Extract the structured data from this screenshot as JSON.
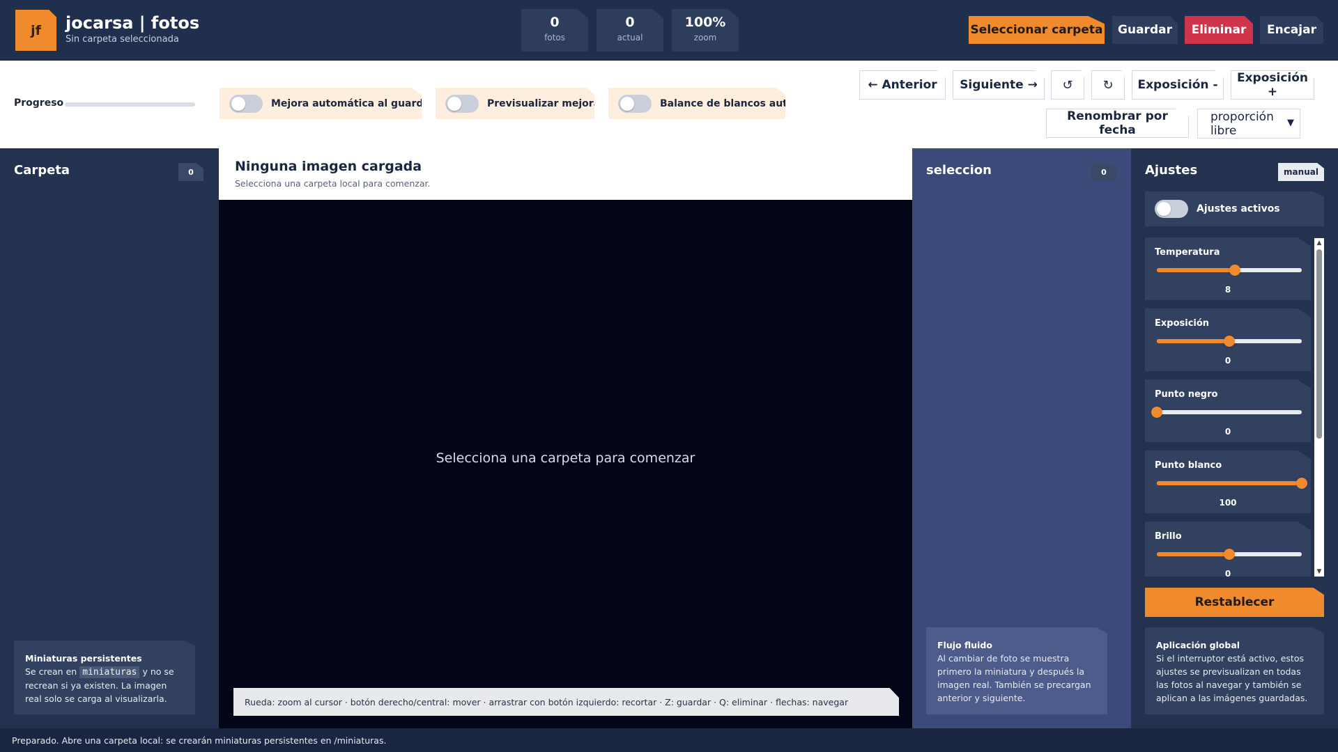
{
  "header": {
    "logo_text": "jf",
    "title": "jocarsa | fotos",
    "subtitle": "Sin carpeta seleccionada",
    "stats": [
      {
        "value": "0",
        "label": "fotos"
      },
      {
        "value": "0",
        "label": "actual"
      },
      {
        "value": "100%",
        "label": "zoom"
      }
    ],
    "buttons": {
      "select_folder": "Seleccionar carpeta",
      "save": "Guardar",
      "delete": "Eliminar",
      "fit": "Encajar"
    }
  },
  "toolbar": {
    "progress_label": "Progreso",
    "progress_fraction": 0,
    "toggles": {
      "auto_enhance": "Mejora automática al guardar",
      "preview_enhance": "Previsualizar mejora",
      "auto_white_balance": "Balance de blancos auto"
    },
    "buttons": {
      "previous": "← Anterior",
      "next": "Siguiente →",
      "rotate_left": "↺",
      "rotate_right": "↻",
      "exposure_minus": "Exposición -",
      "exposure_plus": "Exposición +",
      "rename_by_date": "Renombrar por fecha"
    },
    "ratio_select": "proporción libre"
  },
  "folder_panel": {
    "title": "Carpeta",
    "count": "0",
    "info": {
      "title": "Miniaturas persistentes",
      "text_before": "Se crean en",
      "code": "miniaturas",
      "text_after": "y no se recrean si ya existen. La imagen real solo se carga al visualizarla."
    }
  },
  "viewer": {
    "title": "Ninguna imagen cargada",
    "subtitle": "Selecciona una carpeta local para comenzar.",
    "empty_message": "Selecciona una carpeta para comenzar",
    "hint": "Rueda: zoom al cursor · botón derecho/central: mover · arrastrar con botón izquierdo: recortar · Z: guardar · Q: eliminar · flechas: navegar"
  },
  "selection_panel": {
    "title": "seleccion",
    "count": "0",
    "info": {
      "title": "Flujo fluido",
      "text": "Al cambiar de foto se muestra primero la miniatura y después la imagen real. También se precargan anterior y siguiente."
    }
  },
  "adjust_panel": {
    "title": "Ajustes",
    "mode_badge": "manual",
    "active_label": "Ajustes activos",
    "sliders": [
      {
        "label": "Temperatura",
        "value": "8",
        "fraction": 0.54
      },
      {
        "label": "Exposición",
        "value": "0",
        "fraction": 0.5
      },
      {
        "label": "Punto negro",
        "value": "0",
        "fraction": 0.0
      },
      {
        "label": "Punto blanco",
        "value": "100",
        "fraction": 1.0
      },
      {
        "label": "Brillo",
        "value": "0",
        "fraction": 0.5
      }
    ],
    "reset_button": "Restablecer",
    "info": {
      "title": "Aplicación global",
      "text": "Si el interruptor está activo, estos ajustes se previsualizan en todas las fotos al navegar y también se aplican a las imágenes guardadas."
    }
  },
  "status_bar": "Preparado. Abre una carpeta local: se crearán miniaturas persistentes en /miniaturas.",
  "colors": {
    "accent": "#ef8a2d",
    "danger": "#d0344a",
    "header_bg": "#212f4f",
    "selection_panel_bg": "#3b4a78",
    "viewer_bg": "#030617"
  }
}
